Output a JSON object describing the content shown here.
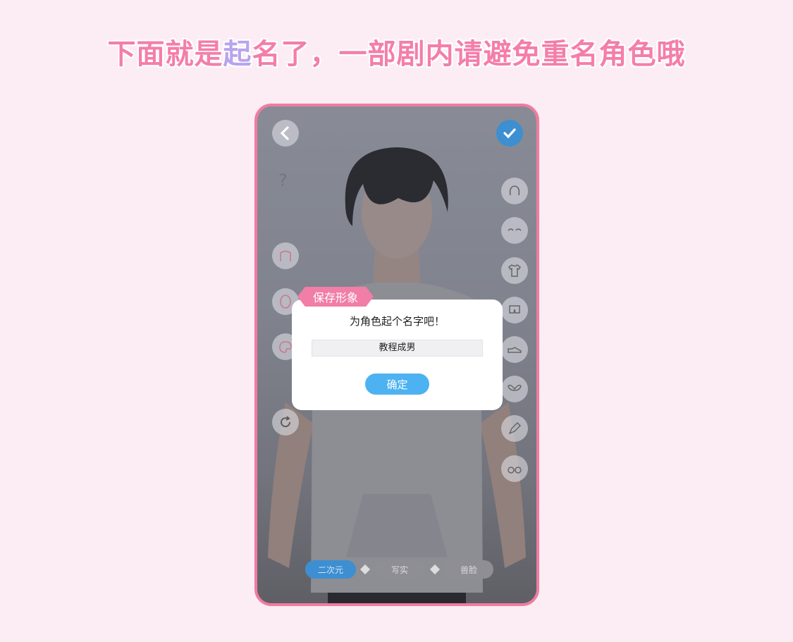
{
  "headline": {
    "part1": "下面就是",
    "accent": "起",
    "part2": "名了，一部剧内请避免重名角色哦"
  },
  "colors": {
    "frame": "#f07c9f",
    "tag": "#f07ea6",
    "confirm": "#4db2f1",
    "check": "#3d8fd1"
  },
  "top_left_icon": "back-chevron-icon",
  "help_label": "?",
  "confirm_icon": "checkmark-icon",
  "left_tools": [
    "body-shape-icon",
    "face-shape-icon",
    "makeup-palette-icon",
    "reset-rotate-icon"
  ],
  "right_tools": [
    "hair-icon",
    "eyebrow-icon",
    "tshirt-icon",
    "pants-icon",
    "shoe-icon",
    "wings-icon",
    "pencil-icon",
    "glasses-icon"
  ],
  "dialog": {
    "tag": "保存形象",
    "title": "为角色起个名字吧！",
    "name_value": "教程成男",
    "confirm_label": "确定"
  },
  "modes": {
    "items": [
      "二次元",
      "写实",
      "兽脸"
    ],
    "selected": "二次元"
  }
}
